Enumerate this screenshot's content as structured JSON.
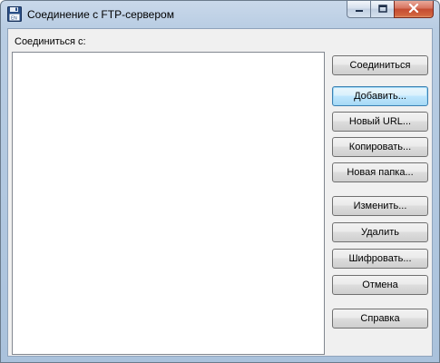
{
  "window": {
    "title": "Соединение с FTP-сервером"
  },
  "icons": {
    "app": "floppy-disk-icon",
    "minimize": "minimize-icon",
    "maximize": "maximize-icon",
    "close": "close-icon"
  },
  "main": {
    "connect_label": "Соединиться с:",
    "list_items": []
  },
  "buttons": {
    "connect": "Соединиться",
    "add": "Добавить...",
    "new_url": "Новый URL...",
    "copy": "Копировать...",
    "new_folder": "Новая папка...",
    "edit": "Изменить...",
    "delete": "Удалить",
    "encrypt": "Шифровать...",
    "cancel": "Отмена",
    "help": "Справка"
  },
  "colors": {
    "close_button": "#c44c32",
    "default_button_border": "#3c7fb1"
  }
}
